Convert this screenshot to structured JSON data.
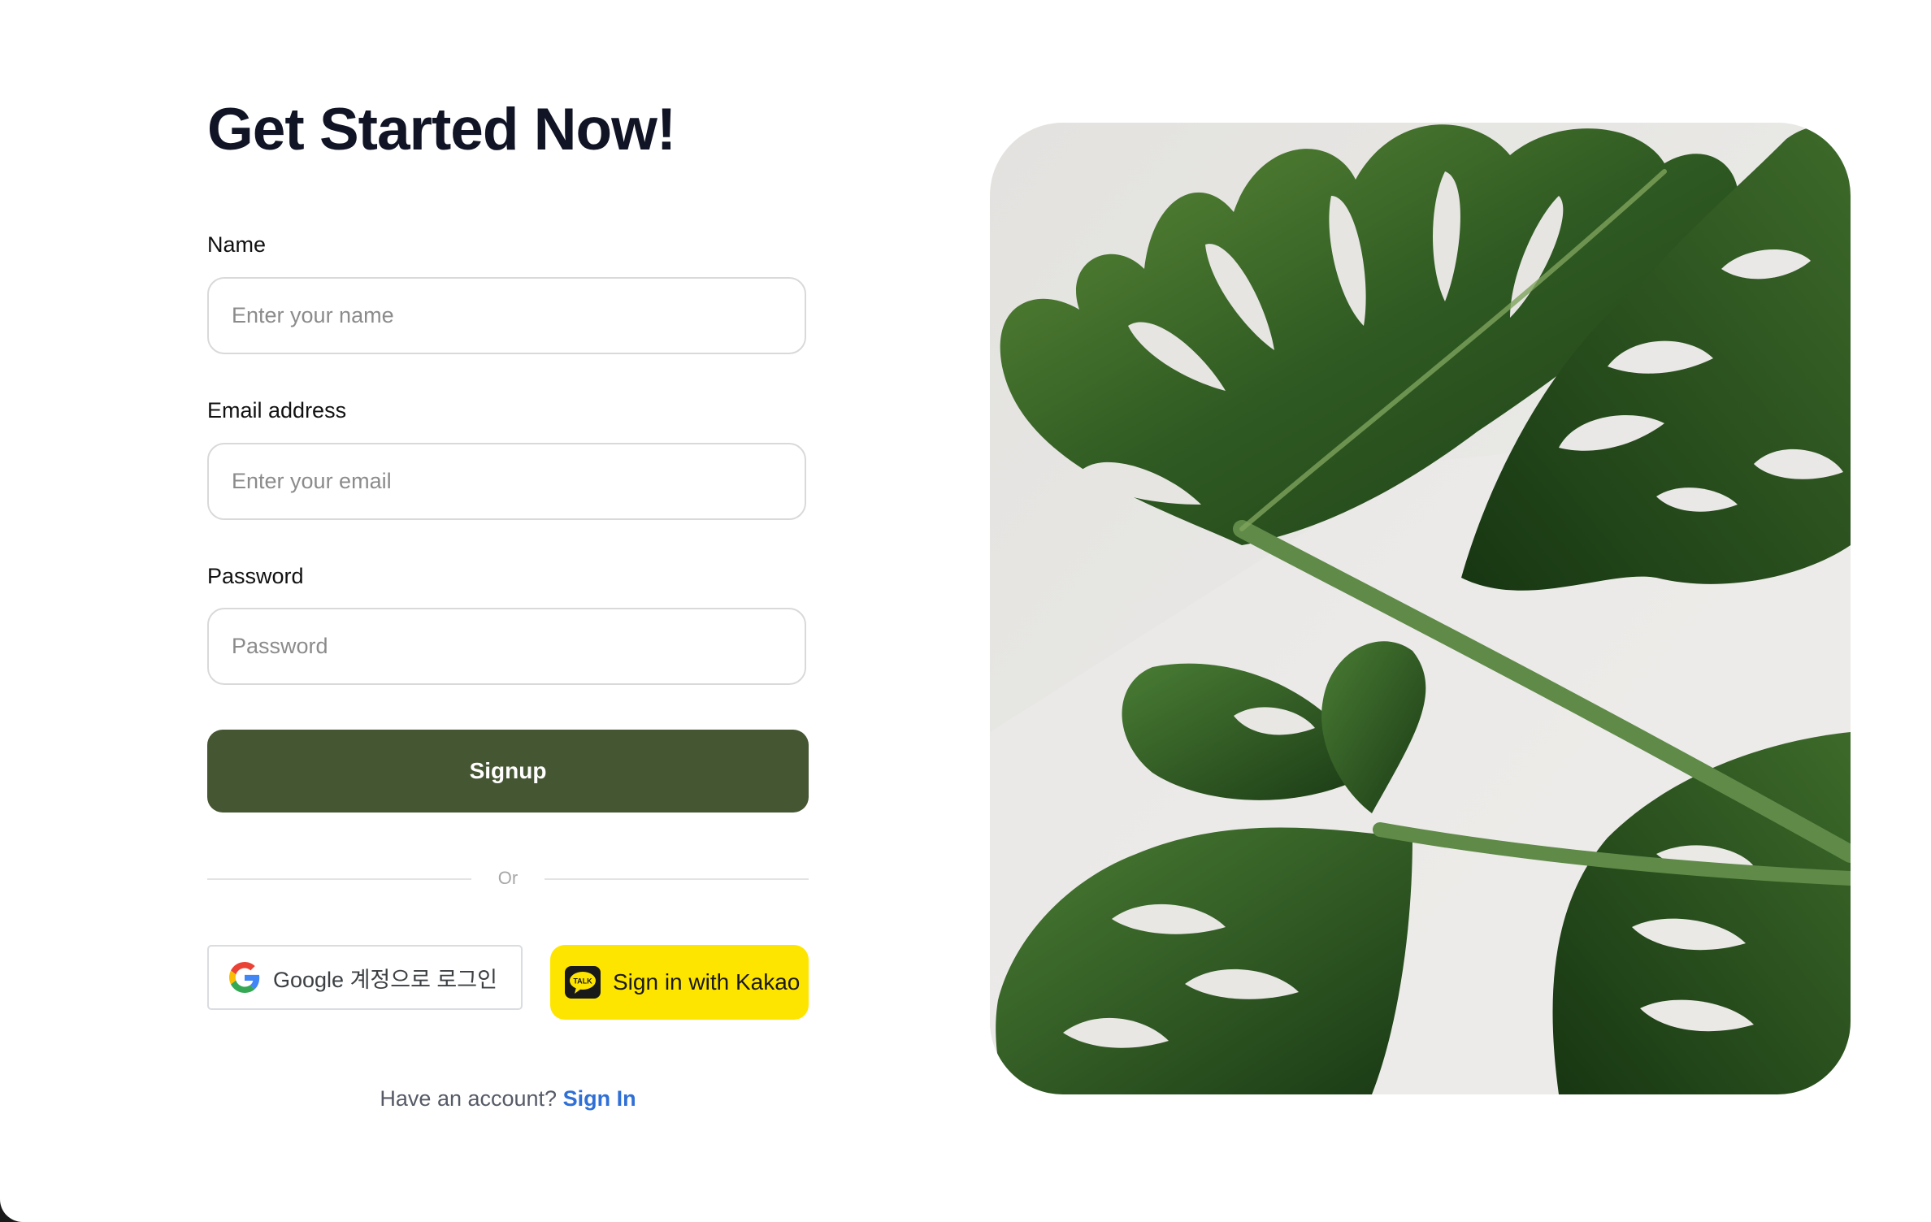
{
  "page": {
    "heading": "Get Started Now!"
  },
  "form": {
    "name": {
      "label": "Name",
      "placeholder": "Enter your name",
      "value": ""
    },
    "email": {
      "label": "Email address",
      "placeholder": "Enter your email",
      "value": ""
    },
    "password": {
      "label": "Password",
      "placeholder": "Password",
      "value": ""
    },
    "submit_label": "Signup",
    "accent_color": "#455632"
  },
  "divider": {
    "label": "Or"
  },
  "social": {
    "google": {
      "label": "Google 계정으로 로그인",
      "icon": "google-g-icon"
    },
    "kakao": {
      "label": "Sign in with Kakao",
      "icon": "kakao-talk-icon",
      "color": "#fee500"
    }
  },
  "footer": {
    "prompt": "Have an account?",
    "link_label": "Sign In",
    "link_color": "#2f6fd6"
  },
  "hero": {
    "image": "monstera-leaves-photo"
  }
}
